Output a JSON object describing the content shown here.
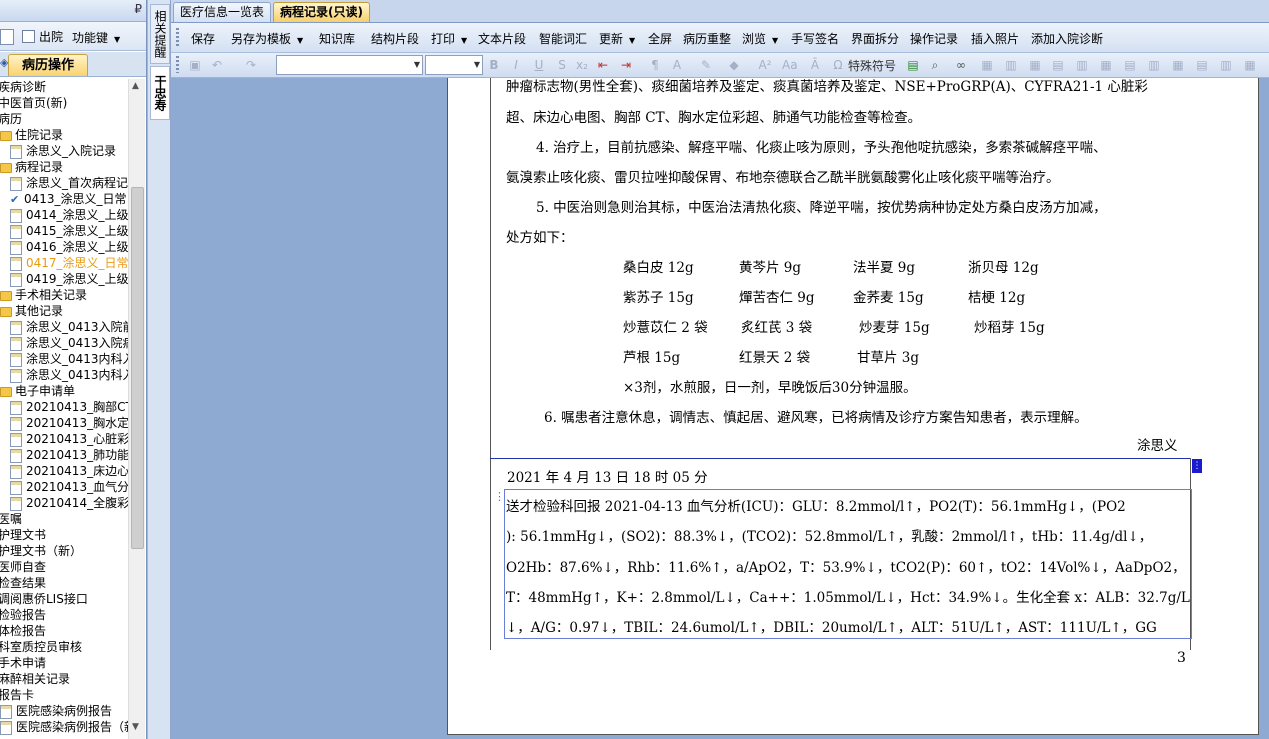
{
  "left_panel": {
    "pin_icon": "pin-icon",
    "option_discharged": "出院",
    "function_key": "功能键",
    "tab_label": "病历操作",
    "tree": [
      {
        "label": "疾病诊断",
        "indent": 0,
        "icon": "none"
      },
      {
        "label": "中医首页(新)",
        "indent": 0,
        "icon": "none"
      },
      {
        "label": "病历",
        "indent": 0,
        "icon": "none"
      },
      {
        "label": "住院记录",
        "indent": 1,
        "icon": "folder"
      },
      {
        "label": "涂思义_入院记录",
        "indent": 2,
        "icon": "doc"
      },
      {
        "label": "病程记录",
        "indent": 1,
        "icon": "folder"
      },
      {
        "label": "涂思义_首次病程记",
        "indent": 2,
        "icon": "doc"
      },
      {
        "label": "0413_涂思义_日常",
        "indent": 2,
        "icon": "check"
      },
      {
        "label": "0414_涂思义_上级",
        "indent": 2,
        "icon": "doc"
      },
      {
        "label": "0415_涂思义_上级",
        "indent": 2,
        "icon": "doc"
      },
      {
        "label": "0416_涂思义_上级",
        "indent": 2,
        "icon": "doc"
      },
      {
        "label": "0417_涂思义_日常",
        "indent": 2,
        "icon": "doc",
        "highlight": true
      },
      {
        "label": "0419_涂思义_上级",
        "indent": 2,
        "icon": "doc"
      },
      {
        "label": "手术相关记录",
        "indent": 1,
        "icon": "folder"
      },
      {
        "label": "其他记录",
        "indent": 1,
        "icon": "folder"
      },
      {
        "label": "涂思义_0413入院前",
        "indent": 2,
        "icon": "doc"
      },
      {
        "label": "涂思义_0413入院病",
        "indent": 2,
        "icon": "doc"
      },
      {
        "label": "涂思义_0413内科入",
        "indent": 2,
        "icon": "doc"
      },
      {
        "label": "涂思义_0413内科入",
        "indent": 2,
        "icon": "doc"
      },
      {
        "label": "电子申请单",
        "indent": 1,
        "icon": "folder"
      },
      {
        "label": "20210413_胸部CT平",
        "indent": 2,
        "icon": "doc"
      },
      {
        "label": "20210413_胸水定位",
        "indent": 2,
        "icon": "doc"
      },
      {
        "label": "20210413_心脏彩超",
        "indent": 2,
        "icon": "doc"
      },
      {
        "label": "20210413_肺功能检",
        "indent": 2,
        "icon": "doc"
      },
      {
        "label": "20210413_床边心电",
        "indent": 2,
        "icon": "doc"
      },
      {
        "label": "20210413_血气分析",
        "indent": 2,
        "icon": "doc"
      },
      {
        "label": "20210414_全腹彩超",
        "indent": 2,
        "icon": "doc"
      },
      {
        "label": "医嘱",
        "indent": 0,
        "icon": "none"
      },
      {
        "label": "护理文书",
        "indent": 0,
        "icon": "none"
      },
      {
        "label": "护理文书（新）",
        "indent": 0,
        "icon": "none"
      },
      {
        "label": "医师自查",
        "indent": 0,
        "icon": "none"
      },
      {
        "label": "检查结果",
        "indent": 0,
        "icon": "none"
      },
      {
        "label": "调阅惠侨LIS接口",
        "indent": 0,
        "icon": "none"
      },
      {
        "label": "检验报告",
        "indent": 0,
        "icon": "none"
      },
      {
        "label": "体检报告",
        "indent": 0,
        "icon": "none"
      },
      {
        "label": "科室质控员审核",
        "indent": 0,
        "icon": "none"
      },
      {
        "label": "手术申请",
        "indent": 0,
        "icon": "none"
      },
      {
        "label": "麻醉相关记录",
        "indent": 0,
        "icon": "none"
      },
      {
        "label": "报告卡",
        "indent": 0,
        "icon": "none"
      },
      {
        "label": "医院感染病例报告",
        "indent": 1,
        "icon": "doc"
      },
      {
        "label": "医院感染病例报告（新",
        "indent": 1,
        "icon": "doc"
      }
    ]
  },
  "side_strip": {
    "tab1": "相关提醒",
    "tab2": "干忠寿"
  },
  "tabs": [
    {
      "label": "医疗信息一览表",
      "active": false
    },
    {
      "label": "病程记录(只读)",
      "active": true
    }
  ],
  "toolbar1": [
    {
      "label": "保存",
      "dropdown": false
    },
    {
      "label": "另存为模板",
      "dropdown": true
    },
    {
      "label": "知识库",
      "dropdown": false
    },
    {
      "label": "结构片段",
      "dropdown": false
    },
    {
      "label": "打印",
      "dropdown": true
    },
    {
      "label": "文本片段",
      "dropdown": false
    },
    {
      "label": "智能词汇",
      "dropdown": false
    },
    {
      "label": "更新",
      "dropdown": true
    },
    {
      "label": "全屏",
      "dropdown": false
    },
    {
      "label": "病历重整",
      "dropdown": false
    },
    {
      "label": "浏览",
      "dropdown": true
    },
    {
      "label": "手写签名",
      "dropdown": false
    },
    {
      "label": "界面拆分",
      "dropdown": false
    },
    {
      "label": "操作记录",
      "dropdown": false
    },
    {
      "label": "插入照片",
      "dropdown": false
    },
    {
      "label": "添加入院诊断",
      "dropdown": false
    }
  ],
  "toolbar2": {
    "font_value": "",
    "size_value": "",
    "special_symbol": "特殊符号"
  },
  "document": {
    "lines": [
      "肿瘤标志物(男性全套)、痰细菌培养及鉴定、痰真菌培养及鉴定、NSE+ProGRP(A)、CYFRA21-1 心脏彩",
      "超、床边心电图、胸部 CT、胸水定位彩超、肺通气功能检查等检查。",
      "4. 治疗上，目前抗感染、解痉平喘、化痰止咳为原则，予头孢他啶抗感染，多索茶碱解痉平喘、",
      "氨溴索止咳化痰、雷贝拉唑抑酸保胃、布地奈德联合乙酰半胱氨酸雾化止咳化痰平喘等治疗。",
      "5. 中医治则急则治其标，中医治法清热化痰、降逆平喘，按优势病种协定处方桑白皮汤方加减，",
      "处方如下："
    ],
    "herbs": [
      [
        "桑白皮 12g",
        "黄芩片 9g",
        "法半夏 9g",
        "浙贝母 12g"
      ],
      [
        "紫苏子 15g",
        "燀苦杏仁 9g",
        "金荞麦 15g",
        "桔梗 12g"
      ],
      [
        "炒薏苡仁 2 袋",
        "炙红芪 3 袋",
        "炒麦芽 15g",
        "炒稻芽 15g"
      ],
      [
        "芦根 15g",
        "红景天 2 袋",
        "甘草片 3g",
        ""
      ]
    ],
    "dosage": "×3剂，水煎服，日一剂，早晚饭后30分钟温服。",
    "item6": "6. 嘱患者注意休息，调情志、慎起居、避风寒，已将病情及诊疗方案告知患者，表示理解。",
    "signature": "涂思义",
    "entry_time": "2021 年 4 月 13 日 18 时 05 分",
    "entry_lines": [
      "    送才检验科回报 2021-04-13 血气分析(ICU)：GLU：8.2mmol/l↑，PO2(T)：56.1mmHg↓，(PO2",
      "): 56.1mmHg↓，(SO2)：88.3%↓，(TCO2)：52.8mmol/L↑，乳酸：2mmol/l↑，tHb：11.4g/dl↓，",
      "O2Hb：87.6%↓，Rhb：11.6%↑，a/ApO2，T：53.9%↓，tCO2(P)：60↑，tO2：14Vol%↓，AaDpO2，",
      "T：48mmHg↑，K+：2.8mmol/L↓，Ca++：1.05mmol/L↓，Hct：34.9%↓。生化全套 x：ALB：32.7g/L",
      "↓，A/G：0.97↓，TBIL：24.6umol/L↑，DBIL：20umol/L↑，ALT：51U/L↑，AST：111U/L↑，GG"
    ],
    "page_number": "3"
  }
}
